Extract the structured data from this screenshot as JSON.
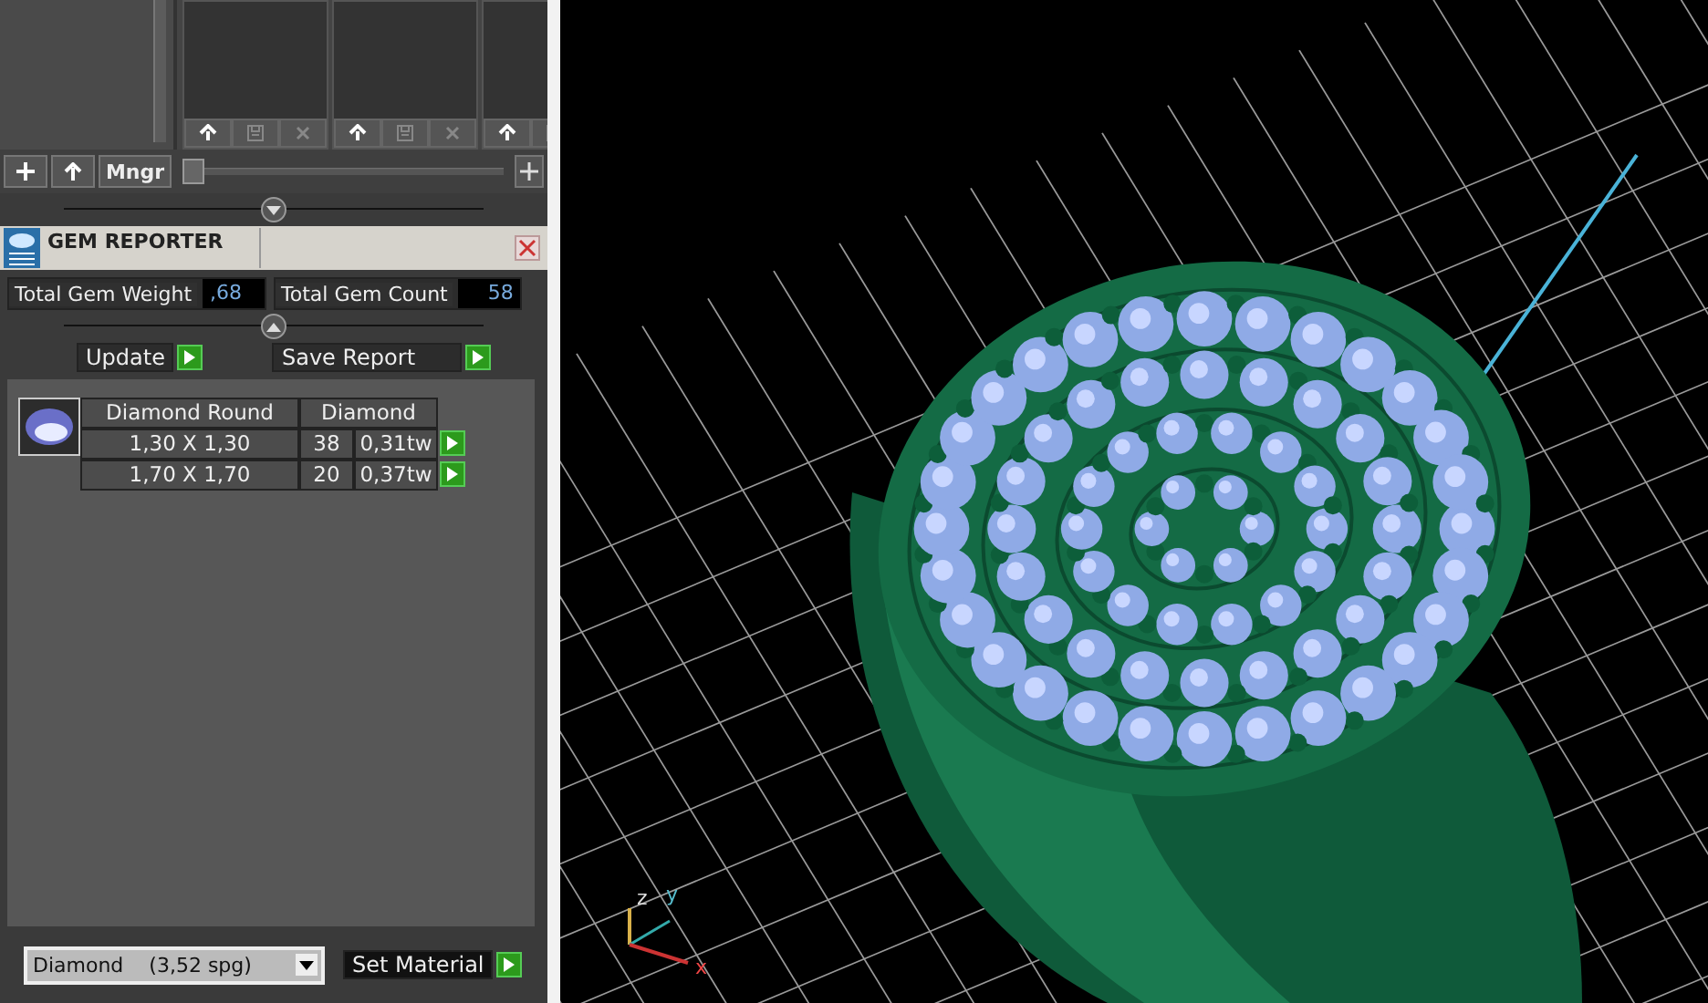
{
  "toolbar": {
    "manager_button": "Mngr",
    "slider": {
      "level": 0
    }
  },
  "gem_reporter": {
    "title": "GEM REPORTER",
    "totals": [
      {
        "label": "Total Gem Weight",
        "value": ",68"
      },
      {
        "label": "Total Gem Count",
        "value": "58"
      }
    ],
    "actions": [
      "Update",
      "Save Report"
    ],
    "table": {
      "shape": "Diamond Round",
      "material": "Diamond",
      "rows": [
        {
          "size": "1,30 X 1,30",
          "count": "38",
          "weight": "0,31tw"
        },
        {
          "size": "1,70 X 1,70",
          "count": "20",
          "weight": "0,37tw"
        }
      ]
    },
    "material_select": {
      "name": "Diamond",
      "density": "(3,52 spg)"
    },
    "set_button": "Set Material"
  },
  "viewport": {
    "axes": [
      "x",
      "y",
      "z"
    ]
  }
}
